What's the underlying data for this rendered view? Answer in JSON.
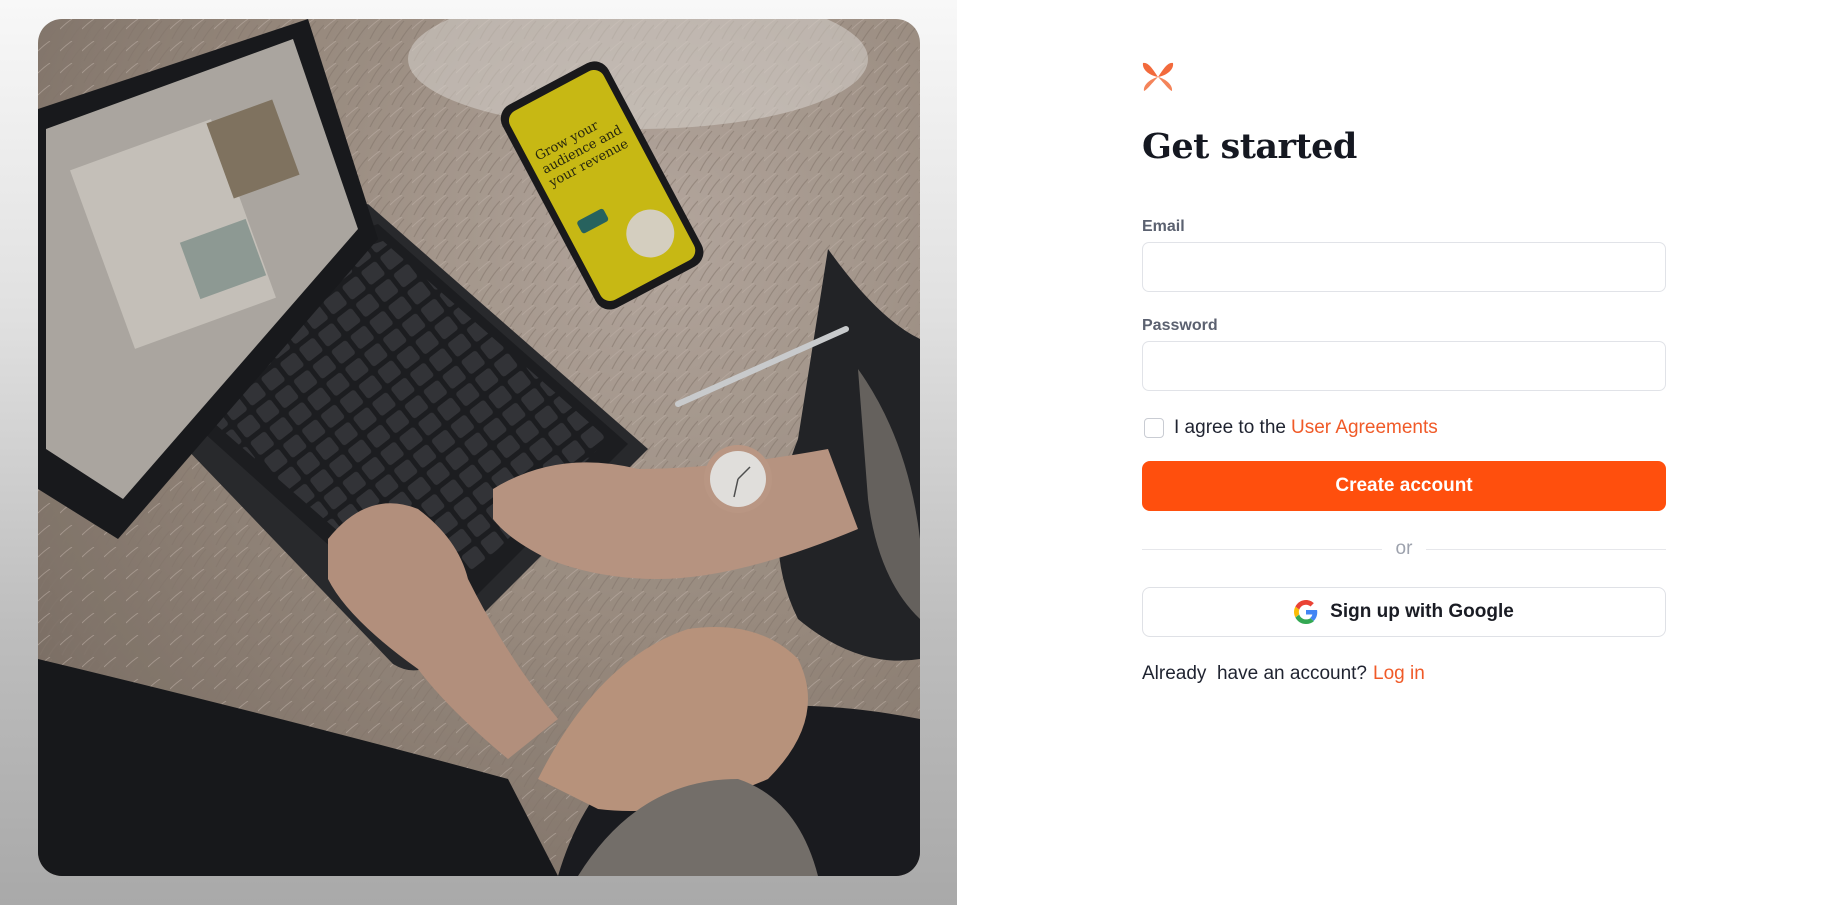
{
  "colors": {
    "accent": "#ff4f0d",
    "link": "#f05a28",
    "text": "#1a1c24",
    "muted": "#5b6170"
  },
  "hero_image": {
    "description_icon": "laptop-photo",
    "phone_screen_lines": [
      "Grow your",
      "audience and",
      "your revenue"
    ]
  },
  "logo": {
    "icon": "butterfly-logo-icon"
  },
  "page": {
    "title": "Get started"
  },
  "form": {
    "email_label": "Email",
    "email_value": "",
    "password_label": "Password",
    "password_value": "",
    "agree_text": "I agree to the",
    "agree_link": "User Agreements",
    "create_button": "Create account",
    "divider_text": "or",
    "google_button": "Sign up with Google",
    "login_prompt": "Already  have an account?",
    "login_link": "Log in"
  }
}
